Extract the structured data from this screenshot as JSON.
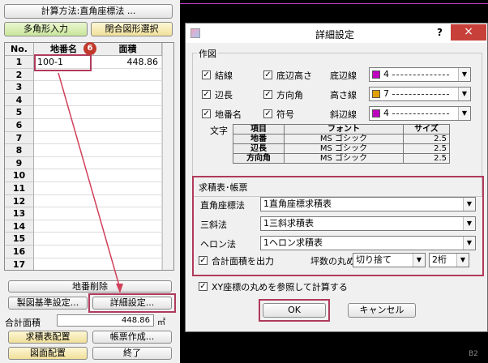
{
  "left_panel": {
    "method_button": "計算方法:直角座標法 ...",
    "polygon_input": "多角形入力",
    "closed_shape_select": "閉合図形選択",
    "grid": {
      "headers": [
        "No.",
        "地番名",
        "面積"
      ],
      "rows": [
        {
          "no": "1",
          "name": "100-1",
          "area": "448.86"
        },
        {
          "no": "2"
        },
        {
          "no": "3"
        },
        {
          "no": "4"
        },
        {
          "no": "5"
        },
        {
          "no": "6"
        },
        {
          "no": "7"
        },
        {
          "no": "8"
        },
        {
          "no": "9"
        },
        {
          "no": "10"
        },
        {
          "no": "11"
        },
        {
          "no": "12"
        },
        {
          "no": "13"
        },
        {
          "no": "14"
        },
        {
          "no": "15"
        },
        {
          "no": "16"
        },
        {
          "no": "17"
        }
      ]
    },
    "callout_number": "6",
    "delete_lot": "地番削除",
    "drawing_standard": "製図基準設定...",
    "detail_settings": "詳細設定...",
    "total_area_label": "合計面積",
    "total_area_value": "448.86",
    "total_area_unit": "㎡",
    "area_table_place": "求積表配置",
    "form_create": "帳票作成...",
    "figure_place": "図面配置",
    "finish": "終了"
  },
  "dialog": {
    "title": "詳細設定",
    "help": "?",
    "close": "×",
    "drawing_group": "作図",
    "checks": [
      {
        "label": "結線",
        "checked": true
      },
      {
        "label": "底辺高さ",
        "checked": true
      },
      {
        "label": "辺長",
        "checked": true
      },
      {
        "label": "方向角",
        "checked": true
      },
      {
        "label": "地番名",
        "checked": true
      },
      {
        "label": "符号",
        "checked": true
      }
    ],
    "lines": [
      {
        "label": "底辺線",
        "value": "4",
        "color": "#c000c0"
      },
      {
        "label": "高さ線",
        "value": "7",
        "color": "#e0a000"
      },
      {
        "label": "斜辺線",
        "value": "4",
        "color": "#c000c0"
      }
    ],
    "text_label": "文字",
    "font_table": {
      "headers": [
        "項目",
        "フォント",
        "サイズ"
      ],
      "rows": [
        [
          "地番",
          "MS ゴシック",
          "2.5"
        ],
        [
          "辺長",
          "MS ゴシック",
          "2.5"
        ],
        [
          "方向角",
          "MS ゴシック",
          "2.5"
        ]
      ]
    },
    "sheet_group": "求積表･帳票",
    "methods": [
      {
        "label": "直角座標法",
        "value": "1直角座標求積表"
      },
      {
        "label": "三斜法",
        "value": "1三斜求積表"
      },
      {
        "label": "ヘロン法",
        "value": "1ヘロン求積表"
      }
    ],
    "total_area_output": "合計面積を出力",
    "tsubo_rounding_label": "坪数の丸め",
    "rounding_mode": "切り捨て",
    "rounding_digits": "2桁",
    "xy_rounding": "XY座標の丸めを参照して計算する",
    "ok": "OK",
    "cancel": "キャンセル"
  },
  "background_label": "B2",
  "colors": {
    "highlight": "#b03a5b",
    "arrow": "#d0405a"
  }
}
